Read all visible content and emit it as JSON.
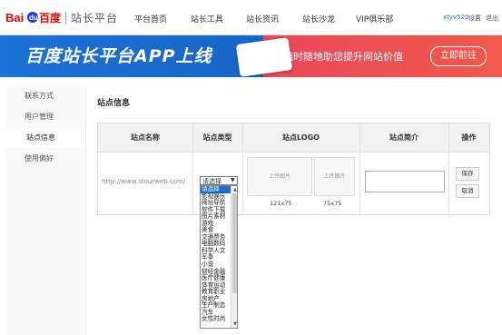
{
  "header": {
    "logo_text": "Baidu百度",
    "brand": "站长平台",
    "nav": [
      "平台首页",
      "站长工具",
      "站长资讯",
      "站长沙龙",
      "VIP俱乐部"
    ],
    "user": "xtyv520",
    "settings": "设置",
    "logout": "退出"
  },
  "banner": {
    "title": "百度站长平台APP上线",
    "subtitle": "随时随地助您提升网站价值",
    "button": "立即前往"
  },
  "sidebar": {
    "items": [
      {
        "label": "联系方式",
        "active": false
      },
      {
        "label": "用户管理",
        "active": false
      },
      {
        "label": "站点信息",
        "active": true
      },
      {
        "label": "使用偏好",
        "active": false
      }
    ]
  },
  "main": {
    "section_title": "站点信息",
    "columns": [
      "站点名称",
      "站点类型",
      "站点LOGO",
      "站点简介",
      "操作"
    ],
    "site_url": "http://www.stourweb.com/",
    "select_value": "请选择",
    "logo_upload_1": "上传图片",
    "logo_size_1": "121x75",
    "logo_upload_2": "上传图片",
    "logo_size_2": "75x75",
    "save": "保存",
    "cancel": "取消",
    "type_options": [
      "请选择",
      "影视娱乐",
      "网址导航",
      "软件下载",
      "图片素材",
      "游戏",
      "美食",
      "交通票务",
      "电脑数码",
      "科学人文",
      "军事",
      "小说",
      "财经金融",
      "医疗健康",
      "体育运动",
      "教育职业",
      "房地产",
      "生产制造",
      "汽车",
      "女性时尚"
    ]
  },
  "colors": {
    "brand_blue": "#1e6fd0",
    "banner_red": "#ec4f52"
  }
}
